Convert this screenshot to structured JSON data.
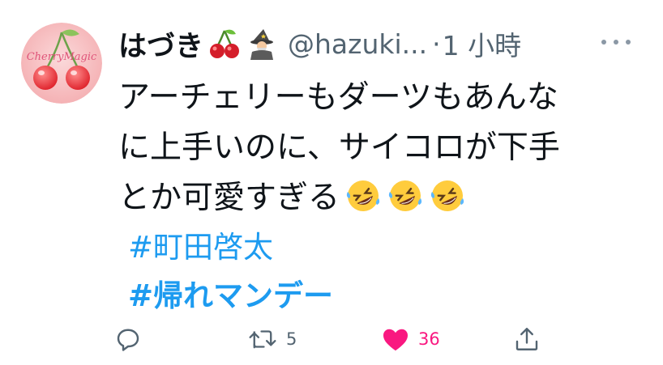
{
  "tweet": {
    "avatar": {
      "text": "CherryMagic",
      "icon": "cherry-avatar"
    },
    "display_name": "はづき",
    "name_emojis": [
      "cherry-emoji",
      "wizard-emoji"
    ],
    "handle": "@hazuki...",
    "separator": "·",
    "time": "1 小時",
    "more_icon": "more-dots-icon",
    "text_lines": [
      "アーチェリーもダーツもあんな",
      "に上手いのに、サイコロが下手",
      "とか可愛すぎる"
    ],
    "trailing_emojis": [
      "rolling-laughing-emoji",
      "rolling-laughing-emoji",
      "rolling-laughing-emoji"
    ],
    "hashtags": [
      "#町田啓太",
      "#帰れマンデー"
    ]
  },
  "actions": {
    "reply": {
      "icon": "reply-icon"
    },
    "retweet": {
      "icon": "retweet-icon",
      "count": "5"
    },
    "like": {
      "icon": "heart-icon",
      "count": "36",
      "liked": true,
      "color": "#f91880"
    },
    "share": {
      "icon": "share-icon"
    }
  },
  "colors": {
    "link": "#1d9bf0",
    "secondary": "#536471",
    "text": "#0f1419"
  }
}
